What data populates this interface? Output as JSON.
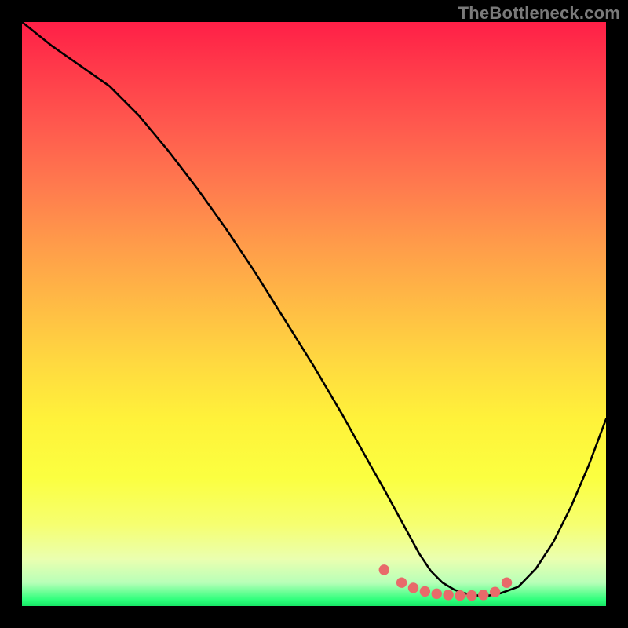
{
  "watermark": "TheBottleneck.com",
  "colors": {
    "frame_bg": "#000000",
    "curve": "#000000",
    "marker": "#e86a6a",
    "watermark": "#7a7a7a"
  },
  "chart_data": {
    "type": "line",
    "title": "",
    "xlabel": "",
    "ylabel": "",
    "xlim": [
      0,
      100
    ],
    "ylim": [
      0,
      100
    ],
    "grid": false,
    "legend": false,
    "series": [
      {
        "name": "curve",
        "x": [
          0,
          5,
          10,
          15,
          20,
          25,
          30,
          35,
          40,
          45,
          50,
          55,
          60,
          62,
          65,
          68,
          70,
          72,
          74,
          76,
          78,
          80,
          82,
          85,
          88,
          91,
          94,
          97,
          100
        ],
        "values": [
          100,
          96,
          92.5,
          89,
          84,
          78,
          71.5,
          64.5,
          57,
          49,
          41,
          32.5,
          23.5,
          20,
          14.5,
          9,
          6,
          4,
          2.8,
          2.1,
          1.8,
          1.8,
          2.2,
          3.3,
          6.4,
          11,
          17,
          24,
          32
        ]
      }
    ],
    "markers": {
      "name": "bottom-cluster",
      "color": "#e86a6a",
      "x": [
        62,
        65,
        67,
        69,
        71,
        73,
        75,
        77,
        79,
        81,
        83
      ],
      "values": [
        6.2,
        4.0,
        3.1,
        2.5,
        2.1,
        1.9,
        1.8,
        1.8,
        1.9,
        2.4,
        4.0
      ]
    }
  }
}
